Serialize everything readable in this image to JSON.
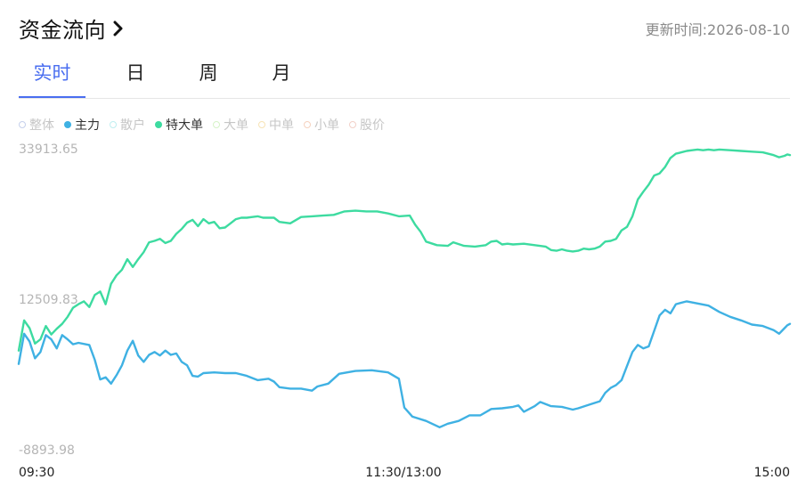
{
  "header": {
    "title": "资金流向",
    "updated_label": "更新时间:",
    "updated_value": "2026-08-10"
  },
  "tabs": [
    {
      "label": "实时",
      "active": true
    },
    {
      "label": "日",
      "active": false
    },
    {
      "label": "周",
      "active": false
    },
    {
      "label": "月",
      "active": false
    }
  ],
  "legend": [
    {
      "label": "整体",
      "color": "#c5d0ec",
      "active": false
    },
    {
      "label": "主力",
      "color": "#3fb1e3",
      "active": true
    },
    {
      "label": "散户",
      "color": "#bfeef0",
      "active": false
    },
    {
      "label": "特大单",
      "color": "#3ddba0",
      "active": true
    },
    {
      "label": "大单",
      "color": "#d6f3c8",
      "active": false
    },
    {
      "label": "中单",
      "color": "#f7e3b5",
      "active": false
    },
    {
      "label": "小单",
      "color": "#f6d2bf",
      "active": false
    },
    {
      "label": "股价",
      "color": "#f2d0c8",
      "active": false
    }
  ],
  "chart_data": {
    "type": "line",
    "y_ticks": [
      "33913.65",
      "12509.83",
      "-8893.98"
    ],
    "ylim": [
      -8893.98,
      33913.65
    ],
    "x_tick_labels": [
      "09:30",
      "11:30/13:00",
      "15:00"
    ],
    "x_count": 241,
    "grid": false,
    "series": [
      {
        "name": "主力",
        "color": "#3fb1e3",
        "points": [
          [
            0,
            3300
          ],
          [
            2,
            7600
          ],
          [
            4,
            6500
          ],
          [
            6,
            4100
          ],
          [
            8,
            5000
          ],
          [
            10,
            7400
          ],
          [
            12,
            6800
          ],
          [
            14,
            5500
          ],
          [
            16,
            7400
          ],
          [
            18,
            6800
          ],
          [
            20,
            6100
          ],
          [
            22,
            6300
          ],
          [
            26,
            6000
          ],
          [
            28,
            3900
          ],
          [
            30,
            1100
          ],
          [
            32,
            1400
          ],
          [
            34,
            500
          ],
          [
            36,
            1700
          ],
          [
            38,
            3100
          ],
          [
            40,
            5200
          ],
          [
            42,
            6600
          ],
          [
            44,
            4500
          ],
          [
            46,
            3600
          ],
          [
            48,
            4600
          ],
          [
            50,
            5000
          ],
          [
            52,
            4500
          ],
          [
            54,
            5200
          ],
          [
            56,
            4600
          ],
          [
            58,
            4800
          ],
          [
            60,
            3600
          ],
          [
            62,
            3100
          ],
          [
            64,
            1600
          ],
          [
            66,
            1500
          ],
          [
            68,
            2000
          ],
          [
            72,
            2100
          ],
          [
            76,
            2000
          ],
          [
            80,
            2000
          ],
          [
            84,
            1600
          ],
          [
            88,
            1000
          ],
          [
            92,
            1200
          ],
          [
            94,
            800
          ],
          [
            96,
            0
          ],
          [
            100,
            -200
          ],
          [
            104,
            -200
          ],
          [
            108,
            -500
          ],
          [
            110,
            100
          ],
          [
            114,
            500
          ],
          [
            118,
            1900
          ],
          [
            124,
            2300
          ],
          [
            130,
            2400
          ],
          [
            136,
            2100
          ],
          [
            140,
            1200
          ],
          [
            142,
            -2900
          ],
          [
            145,
            -4200
          ],
          [
            150,
            -4800
          ],
          [
            155,
            -5700
          ],
          [
            158,
            -5200
          ],
          [
            162,
            -4800
          ],
          [
            166,
            -4000
          ],
          [
            170,
            -4000
          ],
          [
            174,
            -3100
          ],
          [
            178,
            -3000
          ],
          [
            182,
            -2800
          ],
          [
            184,
            -2600
          ],
          [
            186,
            -3500
          ],
          [
            190,
            -2700
          ],
          [
            192,
            -2100
          ],
          [
            196,
            -2700
          ],
          [
            200,
            -2800
          ],
          [
            204,
            -3200
          ],
          [
            206,
            -3000
          ],
          [
            210,
            -2500
          ],
          [
            214,
            -2000
          ],
          [
            216,
            -800
          ],
          [
            218,
            -100
          ],
          [
            220,
            300
          ],
          [
            222,
            1000
          ],
          [
            224,
            3000
          ],
          [
            226,
            5000
          ],
          [
            228,
            6000
          ],
          [
            230,
            5500
          ],
          [
            232,
            5800
          ],
          [
            234,
            8000
          ],
          [
            236,
            10200
          ],
          [
            238,
            11000
          ],
          [
            240,
            10500
          ],
          [
            242,
            11800
          ],
          [
            246,
            12200
          ],
          [
            250,
            11900
          ],
          [
            254,
            11600
          ],
          [
            258,
            10700
          ],
          [
            262,
            10000
          ],
          [
            266,
            9500
          ],
          [
            270,
            8900
          ],
          [
            274,
            8700
          ],
          [
            278,
            8100
          ],
          [
            280,
            7600
          ],
          [
            282,
            8400
          ],
          [
            283,
            8800
          ],
          [
            284,
            9000
          ]
        ]
      },
      {
        "name": "特大单",
        "color": "#3ddba0",
        "points": [
          [
            0,
            5200
          ],
          [
            2,
            9500
          ],
          [
            4,
            8400
          ],
          [
            6,
            6200
          ],
          [
            8,
            6800
          ],
          [
            10,
            8700
          ],
          [
            12,
            7500
          ],
          [
            14,
            8300
          ],
          [
            16,
            9000
          ],
          [
            18,
            10000
          ],
          [
            20,
            11300
          ],
          [
            22,
            11800
          ],
          [
            24,
            12200
          ],
          [
            26,
            11400
          ],
          [
            28,
            13100
          ],
          [
            30,
            13600
          ],
          [
            32,
            11800
          ],
          [
            34,
            14700
          ],
          [
            36,
            15900
          ],
          [
            38,
            16700
          ],
          [
            40,
            18200
          ],
          [
            42,
            17100
          ],
          [
            44,
            18200
          ],
          [
            46,
            19200
          ],
          [
            48,
            20600
          ],
          [
            50,
            20800
          ],
          [
            52,
            21100
          ],
          [
            54,
            20500
          ],
          [
            56,
            20800
          ],
          [
            58,
            21800
          ],
          [
            60,
            22500
          ],
          [
            62,
            23400
          ],
          [
            64,
            23800
          ],
          [
            66,
            22900
          ],
          [
            68,
            23900
          ],
          [
            70,
            23300
          ],
          [
            72,
            23500
          ],
          [
            74,
            22600
          ],
          [
            76,
            22700
          ],
          [
            78,
            23300
          ],
          [
            80,
            23900
          ],
          [
            82,
            24100
          ],
          [
            84,
            24100
          ],
          [
            86,
            24200
          ],
          [
            88,
            24300
          ],
          [
            90,
            24100
          ],
          [
            94,
            24100
          ],
          [
            96,
            23500
          ],
          [
            100,
            23300
          ],
          [
            104,
            24200
          ],
          [
            108,
            24300
          ],
          [
            112,
            24400
          ],
          [
            116,
            24500
          ],
          [
            120,
            25000
          ],
          [
            124,
            25100
          ],
          [
            128,
            25000
          ],
          [
            132,
            25000
          ],
          [
            136,
            24700
          ],
          [
            140,
            24300
          ],
          [
            144,
            24400
          ],
          [
            146,
            23100
          ],
          [
            148,
            22100
          ],
          [
            150,
            20700
          ],
          [
            154,
            20200
          ],
          [
            158,
            20100
          ],
          [
            160,
            20600
          ],
          [
            164,
            20100
          ],
          [
            168,
            20000
          ],
          [
            172,
            20200
          ],
          [
            174,
            20700
          ],
          [
            176,
            20800
          ],
          [
            178,
            20300
          ],
          [
            180,
            20400
          ],
          [
            182,
            20300
          ],
          [
            186,
            20400
          ],
          [
            190,
            20200
          ],
          [
            194,
            20000
          ],
          [
            196,
            19500
          ],
          [
            198,
            19400
          ],
          [
            200,
            19600
          ],
          [
            202,
            19400
          ],
          [
            204,
            19300
          ],
          [
            206,
            19400
          ],
          [
            208,
            19700
          ],
          [
            210,
            19600
          ],
          [
            212,
            19700
          ],
          [
            214,
            20000
          ],
          [
            216,
            20700
          ],
          [
            218,
            20800
          ],
          [
            220,
            21100
          ],
          [
            222,
            22300
          ],
          [
            224,
            22800
          ],
          [
            226,
            24300
          ],
          [
            228,
            26700
          ],
          [
            230,
            27800
          ],
          [
            232,
            28800
          ],
          [
            234,
            30100
          ],
          [
            236,
            30400
          ],
          [
            238,
            31300
          ],
          [
            240,
            32600
          ],
          [
            242,
            33200
          ],
          [
            244,
            33400
          ],
          [
            246,
            33600
          ],
          [
            248,
            33700
          ],
          [
            250,
            33800
          ],
          [
            252,
            33700
          ],
          [
            254,
            33800
          ],
          [
            256,
            33700
          ],
          [
            258,
            33800
          ],
          [
            262,
            33700
          ],
          [
            266,
            33600
          ],
          [
            270,
            33500
          ],
          [
            274,
            33400
          ],
          [
            278,
            33000
          ],
          [
            280,
            32700
          ],
          [
            282,
            32900
          ],
          [
            283,
            33100
          ],
          [
            284,
            33000
          ]
        ]
      }
    ]
  }
}
